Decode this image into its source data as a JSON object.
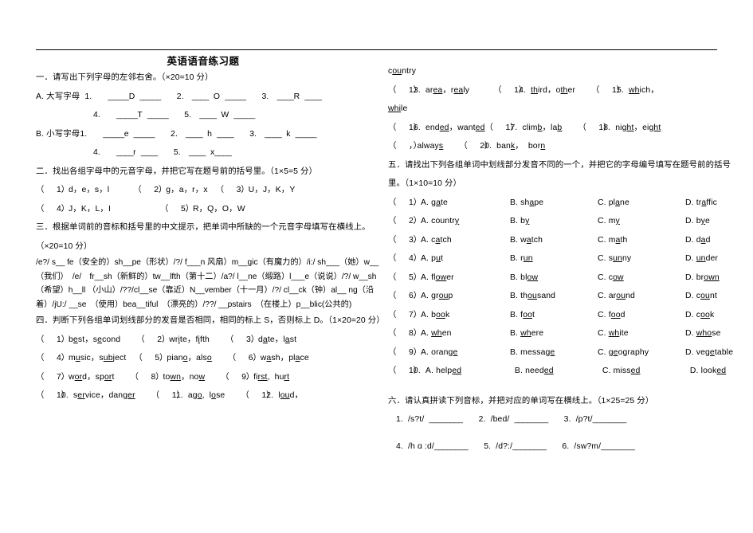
{
  "document": {
    "title": "英语语音练习题"
  },
  "section1": {
    "heading": "一．请写出下列字母的左邻右舍。（×20=10 分）",
    "rowA_label": "A. 大写字母",
    "rowA_items": [
      {
        "num": "1.",
        "blank_before": "_____",
        "letter": "D",
        "blank_after": "_____"
      },
      {
        "num": "2.",
        "blank_before": "____",
        "letter": "O",
        "blank_after": "_____"
      },
      {
        "num": "3.",
        "blank_before": "____",
        "letter": "R",
        "blank_after": "____"
      },
      {
        "num": "4.",
        "blank_before": "_____",
        "letter": "T",
        "blank_after": "_____"
      },
      {
        "num": "5.",
        "blank_before": "____",
        "letter": "W",
        "blank_after": "_____"
      }
    ],
    "rowB_label": "B. 小写字母",
    "rowB_items": [
      {
        "num": "1.",
        "blank_before": "_____",
        "letter": "e",
        "blank_after": "_____"
      },
      {
        "num": "2.",
        "blank_before": "____",
        "letter": "h",
        "blank_after": "____"
      },
      {
        "num": "3.",
        "blank_before": "____",
        "letter": "k",
        "blank_after": "_____"
      },
      {
        "num": "4.",
        "blank_before": "____",
        "letter": "r",
        "blank_after": "____"
      },
      {
        "num": "5.",
        "blank_before": "____",
        "letter": "x",
        "blank_after": "____"
      }
    ]
  },
  "section2": {
    "heading": "二．找出各组字母中的元音字母，并把它写在题号前的括号里。（1×5=5 分）",
    "items": [
      {
        "num": "1.",
        "text": "d，e，s，l"
      },
      {
        "num": "2.",
        "text": "g，a，r，x"
      },
      {
        "num": "3.",
        "text": "U，J，K，Y"
      },
      {
        "num": "4.",
        "text": "J，K，L，I"
      },
      {
        "num": "5.",
        "text": "R，Q，O，W"
      }
    ]
  },
  "section3": {
    "heading": "三．根据单词前的音标和括号里的中文提示，把单词中所缺的一个元音字母填写在横线上。（×20=10 分）",
    "body": "/e?/ s__ fe（安全的）sh__pe（形状）/?/ f___n 风扇）m__gic（有魔力的）/i:/ sh___（她）w__（我们）　/e/　fr__sh（新鲜的）tw__lfth（第十二）/a?/ l__ne（缎路）l___e（说说）/?/ w__sh （希望）h__ll （小山）/??/cl__se（靠近）N__vember（十一月）/?/ cl__ck（钟）al__ ng（沿着）/jU:/ __se　（使用）bea__tiful　（漂亮的）/??/ __pstairs　（在楼上）p__blic(公共的)"
  },
  "section4": {
    "heading": "四．判断下列各组单词划线部分的发音是否相同，相同的标上 S，否则标上 D。（1×20=20 分）",
    "items": [
      {
        "num": "1.",
        "w1_pre": "b",
        "w1_u": "e",
        "w1_post": "st",
        "w2_pre": "s",
        "w2_u": "e",
        "w2_post": "cond"
      },
      {
        "num": "2.",
        "w1_pre": "wr",
        "w1_u": "i",
        "w1_post": "te",
        "w2_pre": "f",
        "w2_u": "i",
        "w2_post": "fth"
      },
      {
        "num": "3.",
        "w1_pre": "d",
        "w1_u": "a",
        "w1_post": "te",
        "w2_pre": "l",
        "w2_u": "a",
        "w2_post": "st"
      },
      {
        "num": "4.",
        "w1_pre": "m",
        "w1_u": "u",
        "w1_post": "sic",
        "w2_pre": "s",
        "w2_u": "ub",
        "w2_post": "ject"
      },
      {
        "num": "5.",
        "w1_pre": "pian",
        "w1_u": "o",
        "w1_post": "",
        "w2_pre": "als",
        "w2_u": "o",
        "w2_post": ""
      },
      {
        "num": "6.",
        "w1_pre": "w",
        "w1_u": "a",
        "w1_post": "sh",
        "w2_pre": "pl",
        "w2_u": "a",
        "w2_post": "ce"
      },
      {
        "num": "7.",
        "w1_pre": "w",
        "w1_u": "or",
        "w1_post": "d",
        "w2_pre": "sp",
        "w2_u": "or",
        "w2_post": "t"
      },
      {
        "num": "8.",
        "w1_pre": "to",
        "w1_u": "wn",
        "w1_post": "",
        "w2_pre": "no",
        "w2_u": "w",
        "w2_post": ""
      },
      {
        "num": "9.",
        "w1_pre": "fi",
        "w1_u": "rst",
        "w1_post": "",
        "w2_pre": "hu",
        "w2_u": "rt",
        "w2_post": ""
      },
      {
        "num": "10.",
        "w1_pre": "s",
        "w1_u": "er",
        "w1_post": "vice",
        "w2_pre": "dang",
        "w2_u": "er",
        "w2_post": ""
      },
      {
        "num": "11.",
        "w1_pre": "ag",
        "w1_u": "o",
        "w1_post": "",
        "w2_pre": "l",
        "w2_u": "o",
        "w2_post": "se"
      },
      {
        "num": "12.",
        "w1_pre": "l",
        "w1_u": "ou",
        "w1_post": "d",
        "w2_pre": "c",
        "w2_u": "ou",
        "w2_post": "ntry"
      },
      {
        "num": "13.",
        "w1_pre": "ar",
        "w1_u": "ea",
        "w1_post": "",
        "w2_pre": "r",
        "w2_u": "ea",
        "w2_post": "ly"
      },
      {
        "num": "14.",
        "w1_pre": "",
        "w1_u": "th",
        "w1_post": "ird",
        "w2_pre": "o",
        "w2_u": "th",
        "w2_post": "er"
      },
      {
        "num": "15.",
        "w1_pre": "",
        "w1_u": "wh",
        "w1_post": "ich",
        "w2_pre": "",
        "w2_u": "whi",
        "w2_post": "le"
      },
      {
        "num": "16.",
        "w1_pre": "end",
        "w1_u": "ed",
        "w1_post": "",
        "w2_pre": "want",
        "w2_u": "ed",
        "w2_post": ""
      },
      {
        "num": "17.",
        "w1_pre": "clim",
        "w1_u": "b",
        "w1_post": "",
        "w2_pre": "la",
        "w2_u": "b",
        "w2_post": ""
      },
      {
        "num": "18.",
        "w1_pre": "ni",
        "w1_u": "ght",
        "w1_post": "",
        "w2_pre": "ei",
        "w2_u": "ght",
        "w2_post": ""
      },
      {
        "num": "",
        "w1_pre": "alway",
        "w1_u": "s",
        "w1_post": "",
        "w2_pre": "",
        "w2_u": "",
        "w2_post": ""
      },
      {
        "num": "20.",
        "w1_pre": "ban",
        "w1_u": "k",
        "w1_post": "",
        "w2_pre": "bor",
        "w2_u": "n",
        "w2_post": ""
      }
    ]
  },
  "section5": {
    "heading": "五．请找出下列各组单词中划线部分发音不同的一个，并把它的字母编号填写在题号前的括号里。（1×10=10 分）",
    "items": [
      {
        "num": "1.",
        "a_pre": "g",
        "a_u": "a",
        "a_post": "te",
        "b_pre": "sh",
        "b_u": "a",
        "b_post": "pe",
        "c_pre": "pl",
        "c_u": "a",
        "c_post": "ne",
        "d_pre": "tr",
        "d_u": "a",
        "d_post": "ffic"
      },
      {
        "num": "2.",
        "a_pre": "countr",
        "a_u": "y",
        "a_post": "",
        "b_pre": "b",
        "b_u": "y",
        "b_post": "",
        "c_pre": "m",
        "c_u": "y",
        "c_post": "",
        "d_pre": "b",
        "d_u": "y",
        "d_post": "e"
      },
      {
        "num": "3.",
        "a_pre": "c",
        "a_u": "a",
        "a_post": "tch",
        "b_pre": "w",
        "b_u": "a",
        "b_post": "tch",
        "c_pre": "m",
        "c_u": "a",
        "c_post": "th",
        "d_pre": "d",
        "d_u": "a",
        "d_post": "d"
      },
      {
        "num": "4.",
        "a_pre": "p",
        "a_u": "u",
        "a_post": "t",
        "b_pre": "r",
        "b_u": "un",
        "b_post": "",
        "c_pre": "s",
        "c_u": "un",
        "c_post": "ny",
        "d_pre": "",
        "d_u": "un",
        "d_post": "der"
      },
      {
        "num": "5.",
        "a_pre": "fl",
        "a_u": "ow",
        "a_post": "er",
        "b_pre": "bl",
        "b_u": "ow",
        "b_post": "",
        "c_pre": "c",
        "c_u": "ow",
        "c_post": "",
        "d_pre": "br",
        "d_u": "own",
        "d_post": ""
      },
      {
        "num": "6.",
        "a_pre": "gr",
        "a_u": "ou",
        "a_post": "p",
        "b_pre": "th",
        "b_u": "ou",
        "b_post": "sand",
        "c_pre": "ar",
        "c_u": "ou",
        "c_post": "nd",
        "d_pre": "c",
        "d_u": "ou",
        "d_post": "nt"
      },
      {
        "num": "7.",
        "a_pre": "b",
        "a_u": "oo",
        "a_post": "k",
        "b_pre": "f",
        "b_u": "oo",
        "b_post": "t",
        "c_pre": "f",
        "c_u": "oo",
        "c_post": "d",
        "d_pre": "c",
        "d_u": "oo",
        "d_post": "k"
      },
      {
        "num": "8.",
        "a_pre": "",
        "a_u": "wh",
        "a_post": "en",
        "b_pre": "",
        "b_u": "wh",
        "b_post": "ere",
        "c_pre": "",
        "c_u": "wh",
        "c_post": "ite",
        "d_pre": "",
        "d_u": "who",
        "d_post": "se"
      },
      {
        "num": "9.",
        "a_pre": "oran",
        "a_u": "ge",
        "a_post": "",
        "b_pre": "messa",
        "b_u": "ge",
        "b_post": "",
        "c_pre": "",
        "c_u": "ge",
        "c_post": "ography",
        "d_pre": "ve",
        "d_u": "ge",
        "d_post": "table"
      },
      {
        "num": "10.",
        "a_pre": "help",
        "a_u": "ed",
        "a_post": "",
        "b_pre": "need",
        "b_u": "ed",
        "b_post": "",
        "c_pre": "miss",
        "c_u": "ed",
        "c_post": "",
        "d_pre": "look",
        "d_u": "ed",
        "d_post": ""
      }
    ],
    "labels": {
      "a": "A.",
      "b": "B.",
      "c": "C.",
      "d": "D."
    }
  },
  "section6": {
    "heading": "六．请认真拼读下列音标，并把对应的单词写在横线上。（1×25=25 分）",
    "items": [
      {
        "num": "1.",
        "ipa": "/s?t/",
        "blank": "________"
      },
      {
        "num": "2.",
        "ipa": "/bed/",
        "blank": "________"
      },
      {
        "num": "3.",
        "ipa": "/p?t/",
        "blank": "________"
      },
      {
        "num": "4.",
        "ipa": "/h ɑ :d/",
        "blank": "________"
      },
      {
        "num": "5.",
        "ipa": "/d?:/",
        "blank": "________"
      },
      {
        "num": "6.",
        "ipa": "/sw?m/",
        "blank": "________"
      }
    ]
  },
  "paren": "（　　）"
}
